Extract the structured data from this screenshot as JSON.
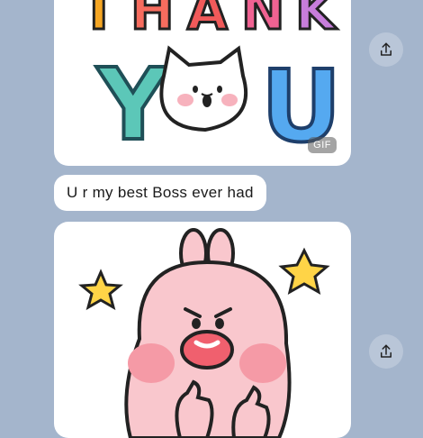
{
  "messages": {
    "gif": {
      "badge": "GIF",
      "caption_line1": "THANK",
      "caption_line2": "YOU"
    },
    "text": {
      "body": "U r my best Boss ever had"
    }
  },
  "icons": {
    "share": "share-icon"
  },
  "colors": {
    "chat_background": "#a4b5cc",
    "bubble": "#ffffff",
    "share_button": "#b9c6d8"
  }
}
